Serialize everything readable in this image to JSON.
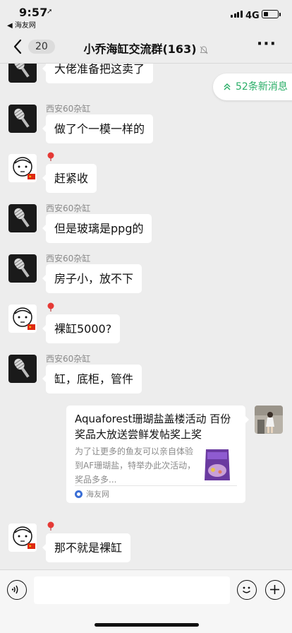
{
  "status_bar": {
    "time": "9:57",
    "back_app": "◀ 海友网",
    "network": "4G",
    "battery_level": 0.35
  },
  "nav": {
    "unread_count": "20",
    "title": "小乔海缸交流群(163)",
    "muted": true
  },
  "new_messages_label": "52条新消息",
  "messages": [
    {
      "sender": "",
      "text": "大佬准备把这卖了",
      "avatar": "mic-avatar"
    },
    {
      "sender": "西安60杂缸",
      "text": "做了个一模一样的",
      "avatar": "mic-avatar"
    },
    {
      "sender": "",
      "text": "赶紧收",
      "avatar": "face-avatar",
      "pin": true
    },
    {
      "sender": "西安60杂缸",
      "text": "但是玻璃是ppg的",
      "avatar": "mic-avatar"
    },
    {
      "sender": "西安60杂缸",
      "text": "房子小，放不下",
      "avatar": "mic-avatar"
    },
    {
      "sender": "",
      "text": "裸缸5000?",
      "avatar": "face-avatar",
      "pin": true
    },
    {
      "sender": "西安60杂缸",
      "text": "缸，底柜，管件",
      "avatar": "mic-avatar"
    },
    {
      "sender": "",
      "text": "那不就是裸缸",
      "avatar": "face-avatar",
      "pin": true
    }
  ],
  "link_card": {
    "title": "Aquaforest珊瑚盐盖楼活动 百份奖品大放送尝鲜发帖奖上奖",
    "description": "为了让更多的鱼友可以亲自体验到AF珊瑚盐，特举办此次活动，奖品多多...",
    "source": "海友网"
  },
  "input": {
    "placeholder": ""
  },
  "colors": {
    "background": "#ededed",
    "bubble": "#ffffff",
    "accent_green": "#2aae67",
    "pin_red": "#e53935"
  }
}
